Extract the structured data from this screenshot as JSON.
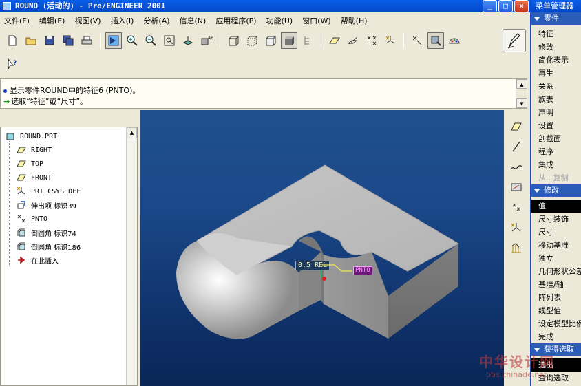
{
  "window": {
    "title": "ROUND (活动的) - Pro/ENGINEER 2001"
  },
  "menubar": [
    "文件(F)",
    "编辑(E)",
    "视图(V)",
    "插入(I)",
    "分析(A)",
    "信息(N)",
    "应用程序(P)",
    "功能(U)",
    "窗口(W)",
    "帮助(H)"
  ],
  "messages": [
    {
      "icon": "info-bullet-icon",
      "text": "显示零件ROUND中的特征6 (PNTO)。"
    },
    {
      "icon": "prompt-arrow-icon",
      "text": "选取“特征”或“尺寸”。"
    }
  ],
  "tree": {
    "root": "ROUND.PRT",
    "items": [
      {
        "label": "RIGHT",
        "icon": "datum-plane-icon",
        "mono": true
      },
      {
        "label": "TOP",
        "icon": "datum-plane-icon",
        "mono": true
      },
      {
        "label": "FRONT",
        "icon": "datum-plane-icon",
        "mono": true
      },
      {
        "label": "PRT_CSYS_DEF",
        "icon": "csys-icon",
        "mono": true
      },
      {
        "label": "伸出项 标识39",
        "icon": "protrusion-icon",
        "mono": false
      },
      {
        "label": "PNTO",
        "icon": "datum-point-icon",
        "mono": true
      },
      {
        "label": "倒圆角 标识74",
        "icon": "round-icon",
        "mono": false
      },
      {
        "label": "倒圆角 标识186",
        "icon": "round-icon",
        "mono": false
      },
      {
        "label": "在此插入",
        "icon": "insert-here-icon",
        "mono": false
      }
    ]
  },
  "viewport": {
    "dimension_label": "0.5 REL",
    "point_label": "PNTO"
  },
  "menu_manager": {
    "title": "菜单管理器",
    "sections": [
      {
        "title": "零件",
        "items": [
          {
            "label": "特征",
            "disabled": false,
            "selected": false
          },
          {
            "label": "修改",
            "disabled": false,
            "selected": false
          },
          {
            "label": "简化表示",
            "disabled": false,
            "selected": false
          },
          {
            "label": "再生",
            "disabled": false,
            "selected": false
          },
          {
            "label": "关系",
            "disabled": false,
            "selected": false
          },
          {
            "label": "族表",
            "disabled": false,
            "selected": false
          },
          {
            "label": "声明",
            "disabled": false,
            "selected": false
          },
          {
            "label": "设置",
            "disabled": false,
            "selected": false
          },
          {
            "label": "剖截面",
            "disabled": false,
            "selected": false
          },
          {
            "label": "程序",
            "disabled": false,
            "selected": false
          },
          {
            "label": "集成",
            "disabled": false,
            "selected": false
          },
          {
            "label": "从...复制",
            "disabled": true,
            "selected": false
          }
        ]
      },
      {
        "title": "修改",
        "items": [
          {
            "label": "值",
            "disabled": false,
            "selected": true
          },
          {
            "label": "尺寸装饰",
            "disabled": false,
            "selected": false
          },
          {
            "label": "尺寸",
            "disabled": false,
            "selected": false
          },
          {
            "label": "移动基准",
            "disabled": false,
            "selected": false
          },
          {
            "label": "独立",
            "disabled": false,
            "selected": false
          },
          {
            "label": "几何形状公差",
            "disabled": false,
            "selected": false
          },
          {
            "label": "基准/轴",
            "disabled": false,
            "selected": false
          },
          {
            "label": "阵列表",
            "disabled": false,
            "selected": false
          },
          {
            "label": "线型值",
            "disabled": false,
            "selected": false
          },
          {
            "label": "设定模型比例",
            "disabled": false,
            "selected": false
          },
          {
            "label": "完成",
            "disabled": false,
            "selected": false
          }
        ]
      },
      {
        "title": "获得选取",
        "items": [
          {
            "label": "选出",
            "disabled": false,
            "selected": true
          },
          {
            "label": "查询选取",
            "disabled": false,
            "selected": false
          }
        ]
      }
    ]
  },
  "watermark": {
    "main": "中华设计网",
    "sub": "bbs.chinade.net"
  },
  "colors": {
    "titlebar": "#0347c9",
    "viewport_top": "#20508d",
    "viewport_bottom": "#0a2658",
    "model_gray": "#b8b8b8",
    "selection_black": "#000000"
  }
}
